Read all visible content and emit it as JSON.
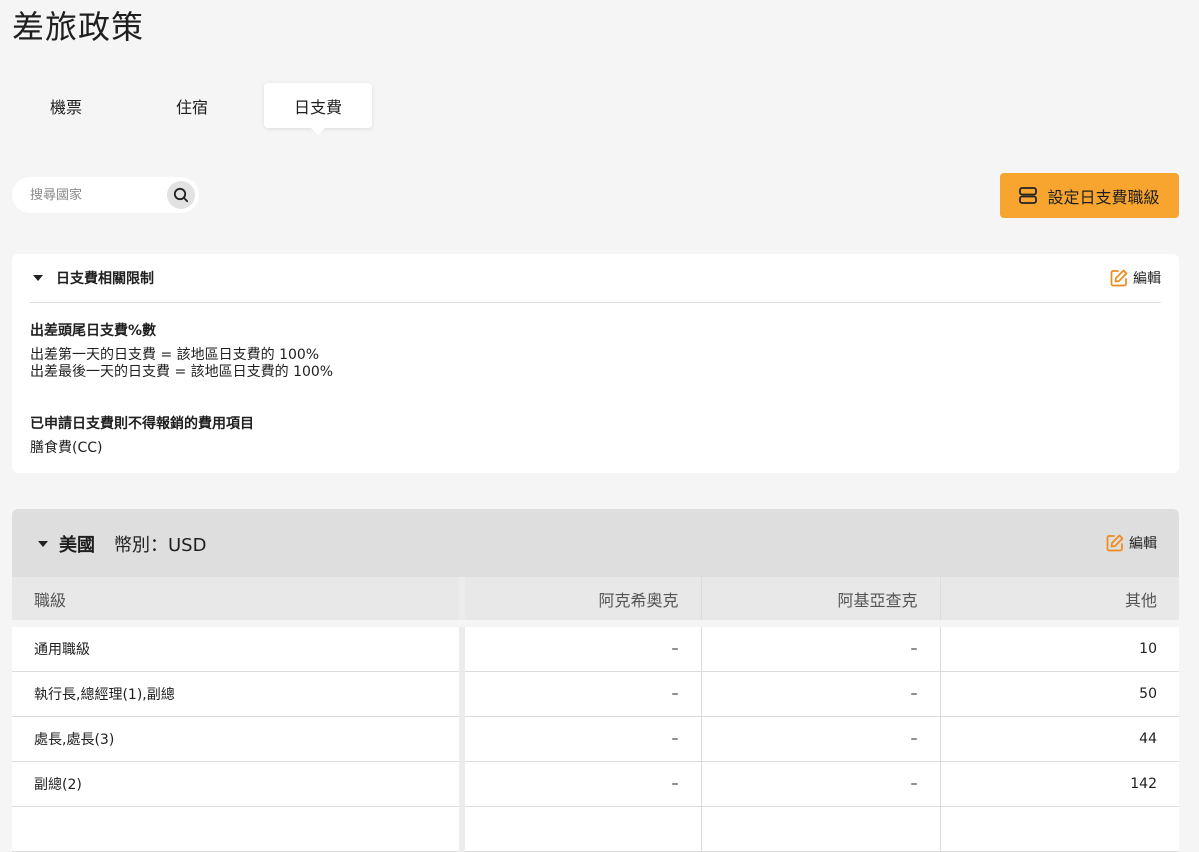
{
  "page": {
    "title": "差旅政策"
  },
  "tabs": [
    {
      "label": "機票",
      "active": false
    },
    {
      "label": "住宿",
      "active": false
    },
    {
      "label": "日支費",
      "active": true
    }
  ],
  "search": {
    "placeholder": "搜尋國家",
    "value": ""
  },
  "toolbar": {
    "set_grade_label": "設定日支費職級",
    "accent_color": "#f8a52f"
  },
  "limits_card": {
    "title": "日支費相關限制",
    "edit_label": "編輯",
    "sections": [
      {
        "title": "出差頭尾日支費%數",
        "lines": [
          "出差第一天的日支費 = 該地區日支費的 100%",
          "出差最後一天的日支費 = 該地區日支費的 100%"
        ]
      },
      {
        "title": "已申請日支費則不得報銷的費用項目",
        "lines": [
          "膳食費(CC)"
        ]
      }
    ]
  },
  "country": {
    "name": "美國",
    "currency_label": "幣別：USD",
    "edit_label": "編輯",
    "columns": [
      "職級",
      "阿克希奧克",
      "阿基亞查克",
      "其他"
    ],
    "rows": [
      [
        "通用職級",
        "–",
        "–",
        "10"
      ],
      [
        "執行長,總經理(1),副總",
        "–",
        "–",
        "50"
      ],
      [
        "處長,處長(3)",
        "–",
        "–",
        "44"
      ],
      [
        "副總(2)",
        "–",
        "–",
        "142"
      ],
      [
        "",
        "",
        "",
        ""
      ]
    ]
  }
}
